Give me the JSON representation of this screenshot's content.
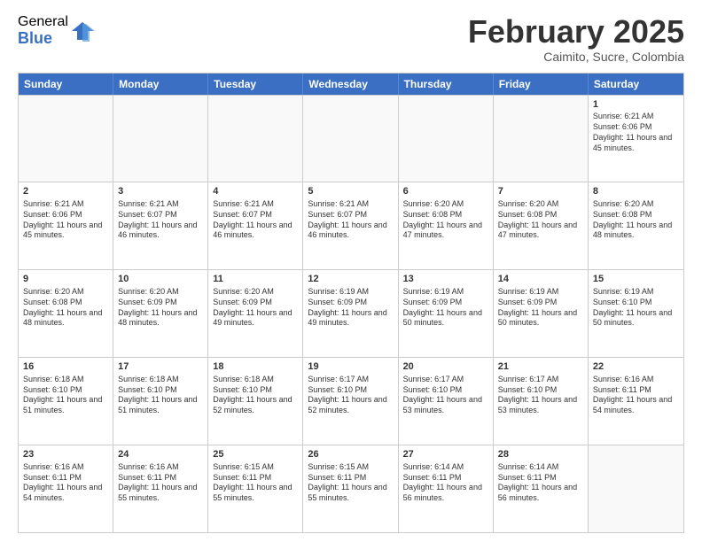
{
  "logo": {
    "general": "General",
    "blue": "Blue"
  },
  "title": "February 2025",
  "subtitle": "Caimito, Sucre, Colombia",
  "weekdays": [
    "Sunday",
    "Monday",
    "Tuesday",
    "Wednesday",
    "Thursday",
    "Friday",
    "Saturday"
  ],
  "weeks": [
    [
      {
        "day": "",
        "text": ""
      },
      {
        "day": "",
        "text": ""
      },
      {
        "day": "",
        "text": ""
      },
      {
        "day": "",
        "text": ""
      },
      {
        "day": "",
        "text": ""
      },
      {
        "day": "",
        "text": ""
      },
      {
        "day": "1",
        "text": "Sunrise: 6:21 AM\nSunset: 6:06 PM\nDaylight: 11 hours and 45 minutes."
      }
    ],
    [
      {
        "day": "2",
        "text": "Sunrise: 6:21 AM\nSunset: 6:06 PM\nDaylight: 11 hours and 45 minutes."
      },
      {
        "day": "3",
        "text": "Sunrise: 6:21 AM\nSunset: 6:07 PM\nDaylight: 11 hours and 46 minutes."
      },
      {
        "day": "4",
        "text": "Sunrise: 6:21 AM\nSunset: 6:07 PM\nDaylight: 11 hours and 46 minutes."
      },
      {
        "day": "5",
        "text": "Sunrise: 6:21 AM\nSunset: 6:07 PM\nDaylight: 11 hours and 46 minutes."
      },
      {
        "day": "6",
        "text": "Sunrise: 6:20 AM\nSunset: 6:08 PM\nDaylight: 11 hours and 47 minutes."
      },
      {
        "day": "7",
        "text": "Sunrise: 6:20 AM\nSunset: 6:08 PM\nDaylight: 11 hours and 47 minutes."
      },
      {
        "day": "8",
        "text": "Sunrise: 6:20 AM\nSunset: 6:08 PM\nDaylight: 11 hours and 48 minutes."
      }
    ],
    [
      {
        "day": "9",
        "text": "Sunrise: 6:20 AM\nSunset: 6:08 PM\nDaylight: 11 hours and 48 minutes."
      },
      {
        "day": "10",
        "text": "Sunrise: 6:20 AM\nSunset: 6:09 PM\nDaylight: 11 hours and 48 minutes."
      },
      {
        "day": "11",
        "text": "Sunrise: 6:20 AM\nSunset: 6:09 PM\nDaylight: 11 hours and 49 minutes."
      },
      {
        "day": "12",
        "text": "Sunrise: 6:19 AM\nSunset: 6:09 PM\nDaylight: 11 hours and 49 minutes."
      },
      {
        "day": "13",
        "text": "Sunrise: 6:19 AM\nSunset: 6:09 PM\nDaylight: 11 hours and 50 minutes."
      },
      {
        "day": "14",
        "text": "Sunrise: 6:19 AM\nSunset: 6:09 PM\nDaylight: 11 hours and 50 minutes."
      },
      {
        "day": "15",
        "text": "Sunrise: 6:19 AM\nSunset: 6:10 PM\nDaylight: 11 hours and 50 minutes."
      }
    ],
    [
      {
        "day": "16",
        "text": "Sunrise: 6:18 AM\nSunset: 6:10 PM\nDaylight: 11 hours and 51 minutes."
      },
      {
        "day": "17",
        "text": "Sunrise: 6:18 AM\nSunset: 6:10 PM\nDaylight: 11 hours and 51 minutes."
      },
      {
        "day": "18",
        "text": "Sunrise: 6:18 AM\nSunset: 6:10 PM\nDaylight: 11 hours and 52 minutes."
      },
      {
        "day": "19",
        "text": "Sunrise: 6:17 AM\nSunset: 6:10 PM\nDaylight: 11 hours and 52 minutes."
      },
      {
        "day": "20",
        "text": "Sunrise: 6:17 AM\nSunset: 6:10 PM\nDaylight: 11 hours and 53 minutes."
      },
      {
        "day": "21",
        "text": "Sunrise: 6:17 AM\nSunset: 6:10 PM\nDaylight: 11 hours and 53 minutes."
      },
      {
        "day": "22",
        "text": "Sunrise: 6:16 AM\nSunset: 6:11 PM\nDaylight: 11 hours and 54 minutes."
      }
    ],
    [
      {
        "day": "23",
        "text": "Sunrise: 6:16 AM\nSunset: 6:11 PM\nDaylight: 11 hours and 54 minutes."
      },
      {
        "day": "24",
        "text": "Sunrise: 6:16 AM\nSunset: 6:11 PM\nDaylight: 11 hours and 55 minutes."
      },
      {
        "day": "25",
        "text": "Sunrise: 6:15 AM\nSunset: 6:11 PM\nDaylight: 11 hours and 55 minutes."
      },
      {
        "day": "26",
        "text": "Sunrise: 6:15 AM\nSunset: 6:11 PM\nDaylight: 11 hours and 55 minutes."
      },
      {
        "day": "27",
        "text": "Sunrise: 6:14 AM\nSunset: 6:11 PM\nDaylight: 11 hours and 56 minutes."
      },
      {
        "day": "28",
        "text": "Sunrise: 6:14 AM\nSunset: 6:11 PM\nDaylight: 11 hours and 56 minutes."
      },
      {
        "day": "",
        "text": ""
      }
    ]
  ]
}
